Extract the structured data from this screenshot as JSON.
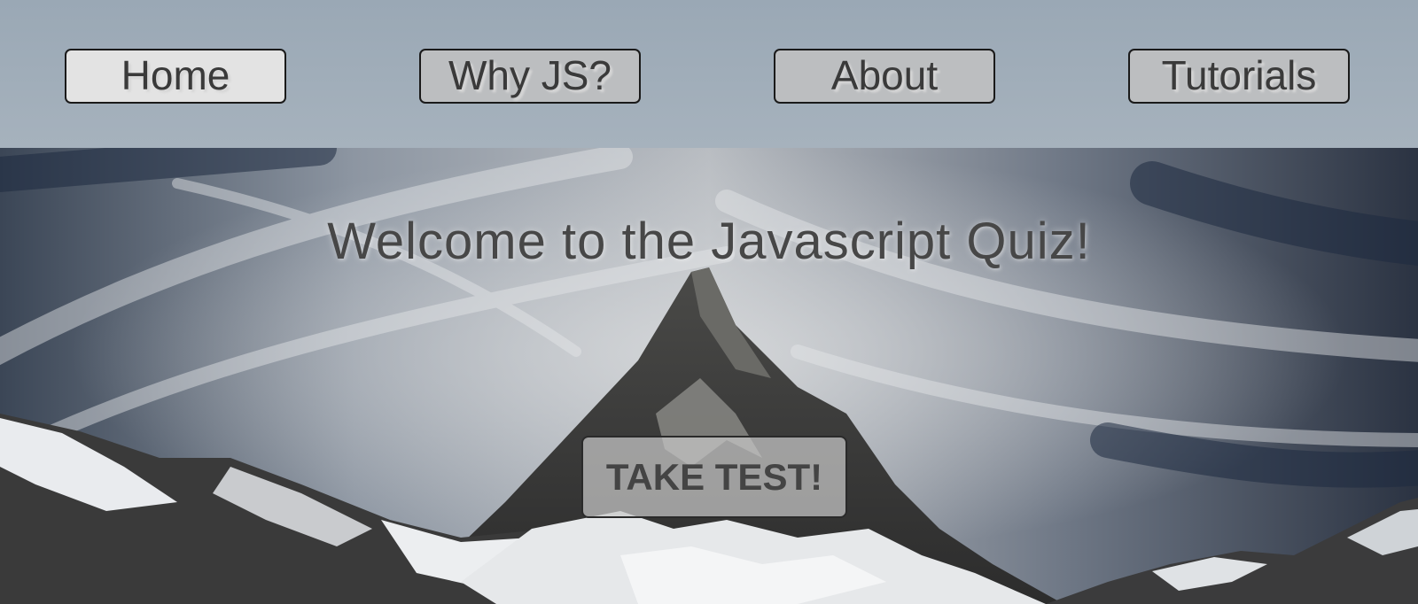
{
  "nav": {
    "items": [
      {
        "label": "Home"
      },
      {
        "label": "Why JS?"
      },
      {
        "label": "About"
      },
      {
        "label": "Tutorials"
      }
    ],
    "active": "Home"
  },
  "hero": {
    "title": "Welcome to the Javascript Quiz!",
    "cta_label": "TAKE TEST!",
    "background_image": "snow-capped mountain peak under cloudy sky"
  },
  "colors": {
    "nav_background": "#a0adb9",
    "button_background": "#bcbec0",
    "active_button_background": "#e3e3e3",
    "text": "#3a3a3a"
  }
}
